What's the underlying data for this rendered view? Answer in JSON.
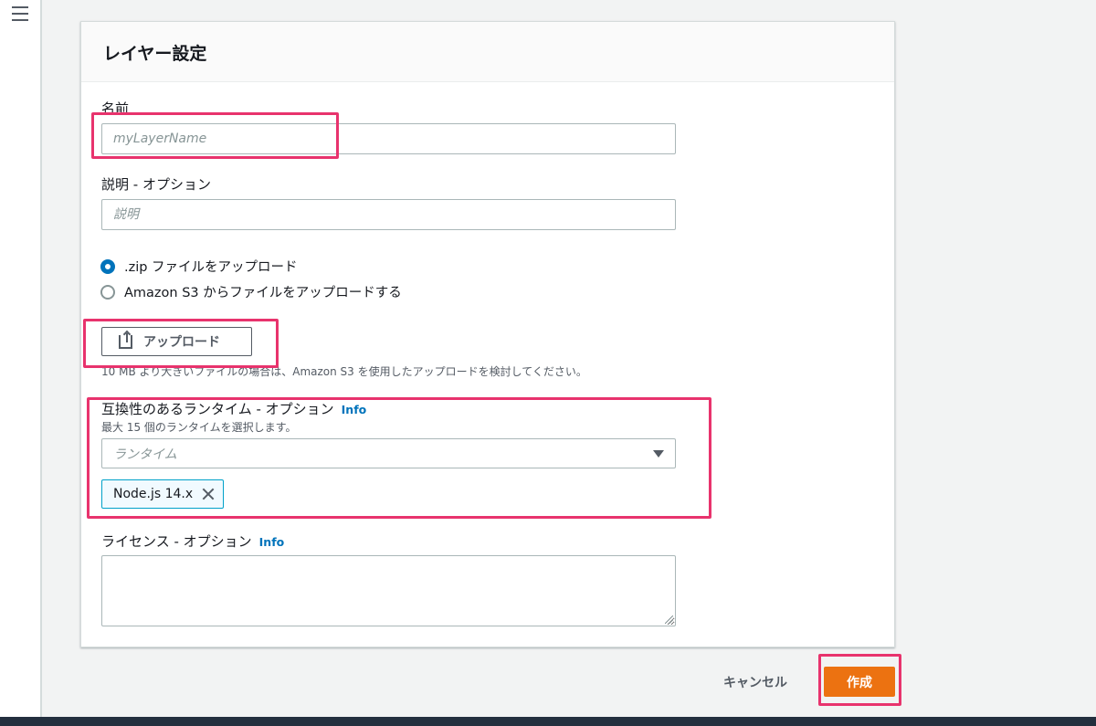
{
  "colors": {
    "accent_orange": "#ec7211",
    "link_blue": "#0073bb",
    "highlight_pink": "#e8336d",
    "token_border": "#00a1c9"
  },
  "nav": {
    "menu_icon": "hamburger-menu-icon"
  },
  "panel": {
    "title": "レイヤー設定",
    "name_field": {
      "label": "名前",
      "placeholder": "myLayerName",
      "value": ""
    },
    "description_field": {
      "label": "説明 - オプション",
      "placeholder": "説明",
      "value": ""
    },
    "upload_options": [
      {
        "label": ".zip ファイルをアップロード",
        "selected": true
      },
      {
        "label": "Amazon S3 からファイルをアップロードする",
        "selected": false
      }
    ],
    "upload_button": {
      "label": "アップロード",
      "icon": "upload-icon"
    },
    "upload_hint": "10 MB より大きいファイルの場合は、Amazon S3 を使用したアップロードを検討してください。",
    "runtimes": {
      "label": "互換性のあるランタイム - オプション",
      "info": "Info",
      "description": "最大 15 個のランタイムを選択します。",
      "placeholder": "ランタイム",
      "selected_tokens": [
        "Node.js 14.x"
      ]
    },
    "license": {
      "label": "ライセンス - オプション",
      "info": "Info",
      "value": ""
    }
  },
  "actions": {
    "cancel": "キャンセル",
    "create": "作成"
  }
}
